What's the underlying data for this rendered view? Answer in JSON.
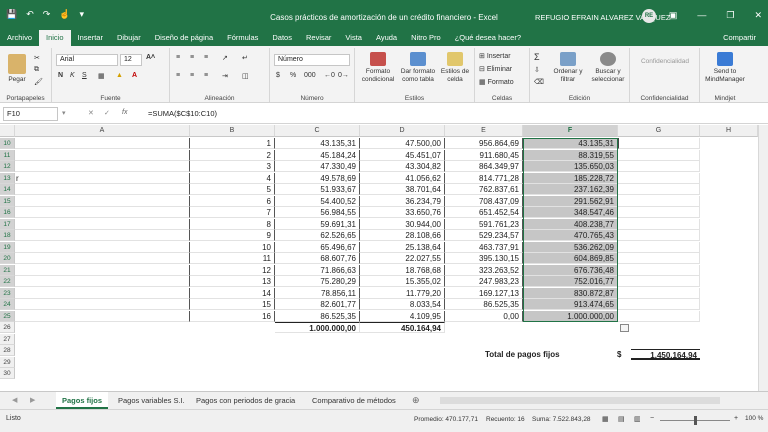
{
  "window": {
    "title": "Casos prácticos de amortización de un crédito financiero  -  Excel",
    "user": "REFUGIO EFRAIN ALVAREZ VAZQUEZ",
    "avatar": "RE"
  },
  "menu": {
    "tabs": [
      "Archivo",
      "Inicio",
      "Insertar",
      "Dibujar",
      "Diseño de página",
      "Fórmulas",
      "Datos",
      "Revisar",
      "Vista",
      "Ayuda",
      "Nitro Pro",
      "¿Qué desea hacer?"
    ],
    "active_index": 1,
    "share": "Compartir"
  },
  "ribbon": {
    "paste_label": "Pegar",
    "font_name": "Arial",
    "font_size": "12",
    "number_format": "Número",
    "cond_format": "Formato condicional",
    "table_format": "Dar formato como tabla",
    "cell_styles": "Estilos de celda",
    "insert": "Insertar",
    "delete": "Eliminar",
    "format": "Formato",
    "sort": "Ordenar y filtrar",
    "find": "Buscar y seleccionar",
    "confidentiality": "Confidencialidad",
    "mindmanager": "Send to MindManager",
    "groups": [
      "Portapapeles",
      "Fuente",
      "Alineación",
      "Número",
      "Estilos",
      "Celdas",
      "Edición",
      "Confidencialidad",
      "Mindjet"
    ]
  },
  "formula_bar": {
    "name_box": "F10",
    "fx": "fx",
    "formula": "=SUMA($C$10:C10)"
  },
  "sheet": {
    "columns": [
      "A",
      "B",
      "C",
      "D",
      "E",
      "F",
      "G",
      "H"
    ],
    "selected_column": "F",
    "row_numbers": [
      "10",
      "11",
      "12",
      "13",
      "14",
      "15",
      "16",
      "17",
      "18",
      "19",
      "20",
      "21",
      "22",
      "23",
      "24",
      "25",
      "26",
      "27",
      "28",
      "29",
      "30"
    ],
    "rows": [
      {
        "a": "",
        "b": "1",
        "c": "43.135,31",
        "d": "47.500,00",
        "e": "956.864,69",
        "f": "43.135,31"
      },
      {
        "a": "",
        "b": "2",
        "c": "45.184,24",
        "d": "45.451,07",
        "e": "911.680,45",
        "f": "88.319,55"
      },
      {
        "a": "",
        "b": "3",
        "c": "47.330,49",
        "d": "43.304,82",
        "e": "864.349,97",
        "f": "135.650,03"
      },
      {
        "a": "r",
        "b": "4",
        "c": "49.578,69",
        "d": "41.056,62",
        "e": "814.771,28",
        "f": "185.228,72"
      },
      {
        "a": "",
        "b": "5",
        "c": "51.933,67",
        "d": "38.701,64",
        "e": "762.837,61",
        "f": "237.162,39"
      },
      {
        "a": "",
        "b": "6",
        "c": "54.400,52",
        "d": "36.234,79",
        "e": "708.437,09",
        "f": "291.562,91"
      },
      {
        "a": "",
        "b": "7",
        "c": "56.984,55",
        "d": "33.650,76",
        "e": "651.452,54",
        "f": "348.547,46"
      },
      {
        "a": "",
        "b": "8",
        "c": "59.691,31",
        "d": "30.944,00",
        "e": "591.761,23",
        "f": "408.238,77"
      },
      {
        "a": "",
        "b": "9",
        "c": "62.526,65",
        "d": "28.108,66",
        "e": "529.234,57",
        "f": "470.765,43"
      },
      {
        "a": "",
        "b": "10",
        "c": "65.496,67",
        "d": "25.138,64",
        "e": "463.737,91",
        "f": "536.262,09"
      },
      {
        "a": "",
        "b": "11",
        "c": "68.607,76",
        "d": "22.027,55",
        "e": "395.130,15",
        "f": "604.869,85"
      },
      {
        "a": "",
        "b": "12",
        "c": "71.866,63",
        "d": "18.768,68",
        "e": "323.263,52",
        "f": "676.736,48"
      },
      {
        "a": "",
        "b": "13",
        "c": "75.280,29",
        "d": "15.355,02",
        "e": "247.983,23",
        "f": "752.016,77"
      },
      {
        "a": "",
        "b": "14",
        "c": "78.856,11",
        "d": "11.779,20",
        "e": "169.127,13",
        "f": "830.872,87"
      },
      {
        "a": "",
        "b": "15",
        "c": "82.601,77",
        "d": "8.033,54",
        "e": "86.525,35",
        "f": "913.474,65"
      },
      {
        "a": "",
        "b": "16",
        "c": "86.525,35",
        "d": "4.109,95",
        "e": "0,00",
        "f": "1.000.000,00"
      }
    ],
    "totals": {
      "c": "1.000.000,00",
      "d": "450.164,94"
    },
    "fixed_total": {
      "label": "Total de pagos fijos",
      "currency": "$",
      "value": "1.450.164,94"
    }
  },
  "sheet_tabs": [
    "Pagos fijos",
    "Pagos variables S.I.",
    "Pagos con periodos de gracia",
    "Comparativo de métodos"
  ],
  "active_sheet": 0,
  "status": {
    "mode": "Listo",
    "average": "Promedio: 470.177,71",
    "count": "Recuento: 16",
    "sum": "Suma: 7.522.843,28",
    "zoom": "100 %"
  },
  "colors": {
    "excel_green": "#217346",
    "selection_gray": "#c6c6c6"
  }
}
